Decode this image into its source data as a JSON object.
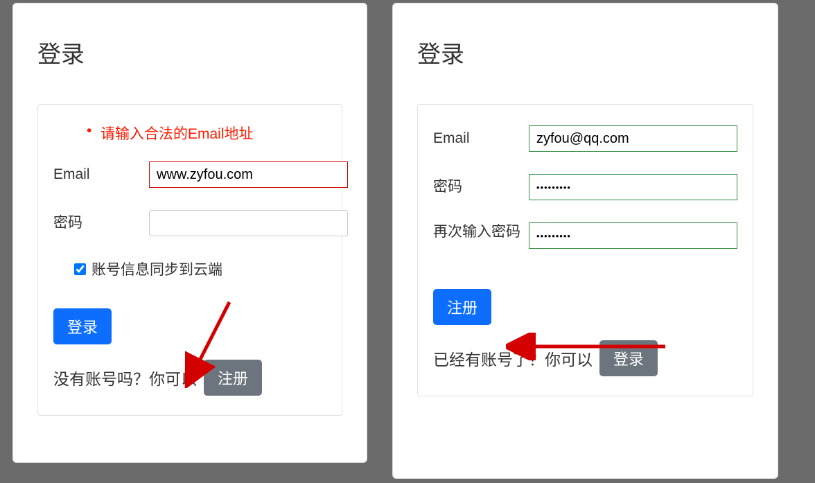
{
  "login_panel": {
    "title": "登录",
    "error_message": "请输入合法的Email地址",
    "email_label": "Email",
    "email_value": "www.zyfou.com",
    "password_label": "密码",
    "password_value": "",
    "sync_checkbox_label": "账号信息同步到云端",
    "submit_button": "登录",
    "no_account_text": "没有账号吗？你可以",
    "register_button": "注册"
  },
  "register_panel": {
    "title": "登录",
    "email_label": "Email",
    "email_value": "zyfou@qq.com",
    "password_label": "密码",
    "password_value": "•••••••••",
    "confirm_label": "再次输入密码",
    "confirm_value": "•••••••••",
    "submit_button": "注册",
    "have_account_text": "已经有账号了？你可以",
    "login_button": "登录"
  }
}
